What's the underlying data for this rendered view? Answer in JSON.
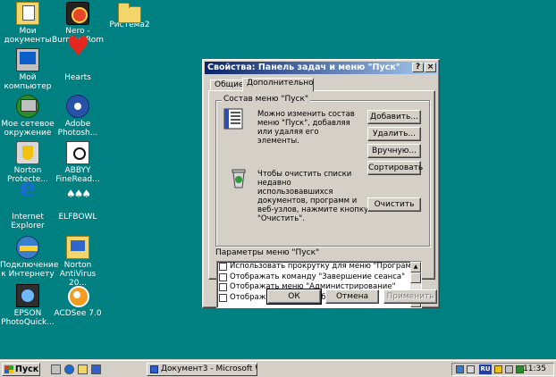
{
  "desktop": {
    "icons": [
      {
        "label": "Мои документы",
        "icon": "my-documents-icon"
      },
      {
        "label": "Nero - Burning Rom",
        "icon": "nero-icon"
      },
      {
        "label": "РисТема2",
        "icon": "folder-icon"
      },
      {
        "label": "Мой компьютер",
        "icon": "my-computer-icon"
      },
      {
        "label": "Hearts",
        "icon": "hearts-icon"
      },
      {
        "label": "Мое сетевое окружение",
        "icon": "network-places-icon"
      },
      {
        "label": "Adobe Photosh...",
        "icon": "adobe-photoshop-icon"
      },
      {
        "label": "Norton Protecte...",
        "icon": "norton-protected-icon"
      },
      {
        "label": "ABBYY FineRead...",
        "icon": "abbyy-finereader-icon"
      },
      {
        "label": "Internet Explorer",
        "icon": "internet-explorer-icon"
      },
      {
        "label": "ELFBOWL",
        "icon": "elfbowl-icon"
      },
      {
        "label": "Подключение к Интернету",
        "icon": "internet-connection-icon"
      },
      {
        "label": "Norton AntiVirus 20...",
        "icon": "norton-antivirus-icon"
      },
      {
        "label": "EPSON PhotoQuick...",
        "icon": "epson-photoquicker-icon"
      },
      {
        "label": "ACDSee 7.0",
        "icon": "acdsee-icon"
      }
    ]
  },
  "dialog": {
    "title": "Свойства: Панель задач и меню \"Пуск\"",
    "help_label": "?",
    "close_label": "×",
    "tabs": [
      {
        "label": "Общие",
        "active": false
      },
      {
        "label": "Дополнительно",
        "active": true
      }
    ],
    "start_menu_group": {
      "title": "Состав меню \"Пуск\"",
      "customize_text": "Можно изменить состав меню \"Пуск\", добавляя или удаляя его элементы.",
      "add_label": "Добавить...",
      "remove_label": "Удалить...",
      "manual_label": "Вручную...",
      "sort_label": "Сортировать",
      "clear_text": "Чтобы очистить списки недавно использовавшихся документов, программ и веб-узлов, нажмите кнопку \"Очистить\".",
      "clear_label": "Очистить"
    },
    "params_group": {
      "title": "Параметры меню \"Пуск\"",
      "items": [
        {
          "label": "Использовать прокрутку для меню \"Программы\"",
          "checked": false
        },
        {
          "label": "Отображать команду \"Завершение сеанса\"",
          "checked": false
        },
        {
          "label": "Отображать меню \"Администрирование\"",
          "checked": false
        },
        {
          "label": "Отображать папку \"Избранное\"",
          "checked": false
        }
      ]
    },
    "ok_label": "ОК",
    "cancel_label": "Отмена",
    "apply_label": "Применить"
  },
  "taskbar": {
    "start_label": "Пуск",
    "task_label": "Документ3 - Microsoft W...",
    "lang": "RU",
    "clock": "11:35"
  }
}
